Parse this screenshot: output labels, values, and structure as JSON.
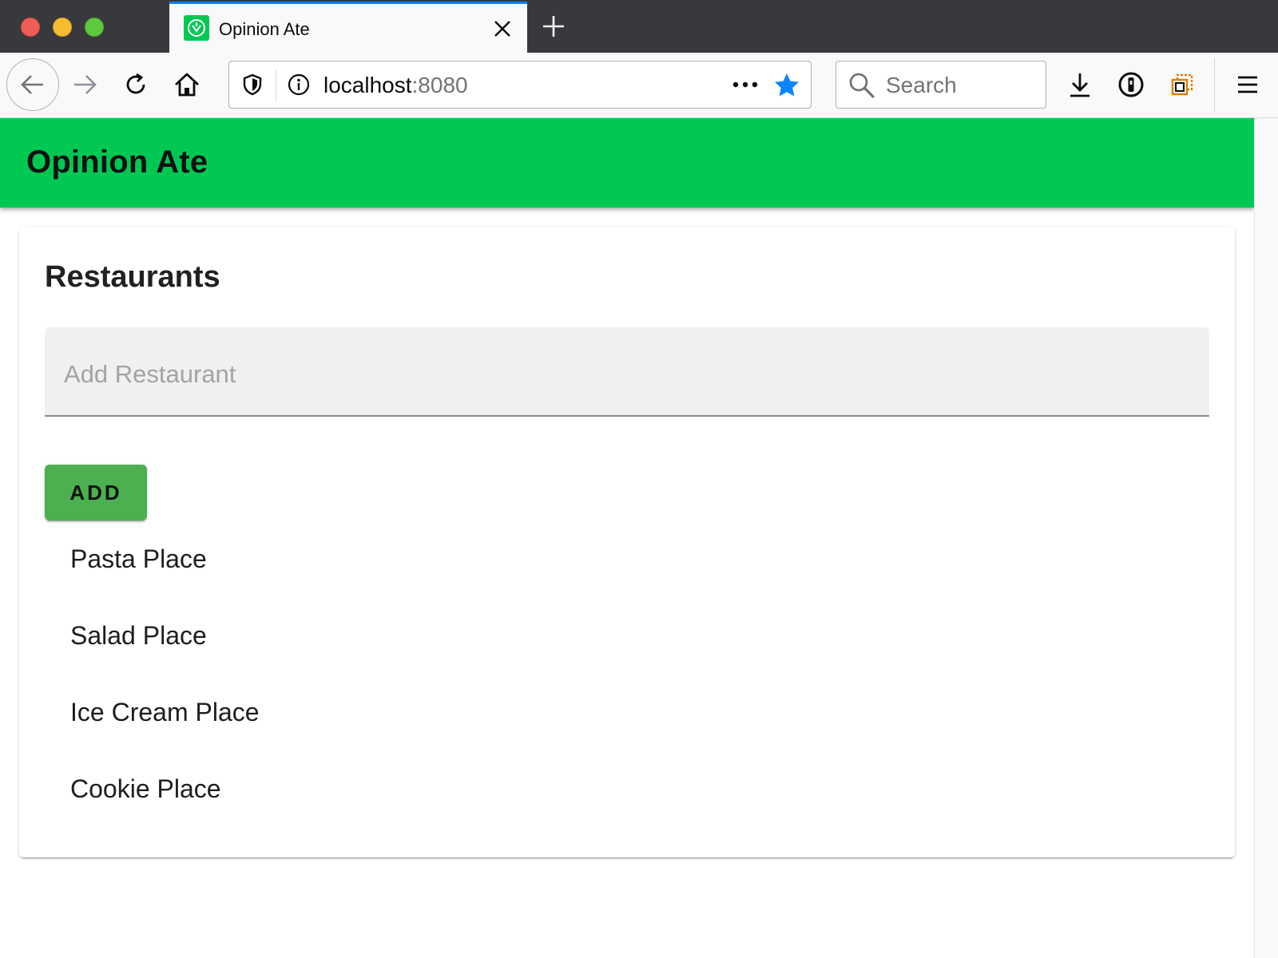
{
  "browser": {
    "tab": {
      "title": "Opinion Ate"
    },
    "url": {
      "host": "localhost",
      "port": ":8080"
    },
    "search": {
      "placeholder": "Search"
    }
  },
  "app": {
    "title": "Opinion Ate",
    "accent_color": "#00c853",
    "restaurants": {
      "heading": "Restaurants",
      "input_placeholder": "Add Restaurant",
      "add_button_label": "ADD",
      "add_button_color": "#4caf50",
      "items": [
        {
          "name": "Pasta Place"
        },
        {
          "name": "Salad Place"
        },
        {
          "name": "Ice Cream Place"
        },
        {
          "name": "Cookie Place"
        }
      ]
    }
  },
  "icons": {
    "tab_favicon": "opinion-ate-favicon-icon",
    "tab_close": "close-icon",
    "new_tab": "plus-icon",
    "back": "arrow-left-icon",
    "forward": "arrow-right-icon",
    "reload": "reload-icon",
    "home": "home-icon",
    "tracking_protection": "shield-icon",
    "site_info": "info-icon",
    "page_actions": "more-horizontal-icon",
    "bookmark": "star-icon",
    "search": "search-icon",
    "downloads": "download-icon",
    "password_manager": "password-manager-icon",
    "extension": "extension-icon",
    "menu": "hamburger-menu-icon"
  }
}
